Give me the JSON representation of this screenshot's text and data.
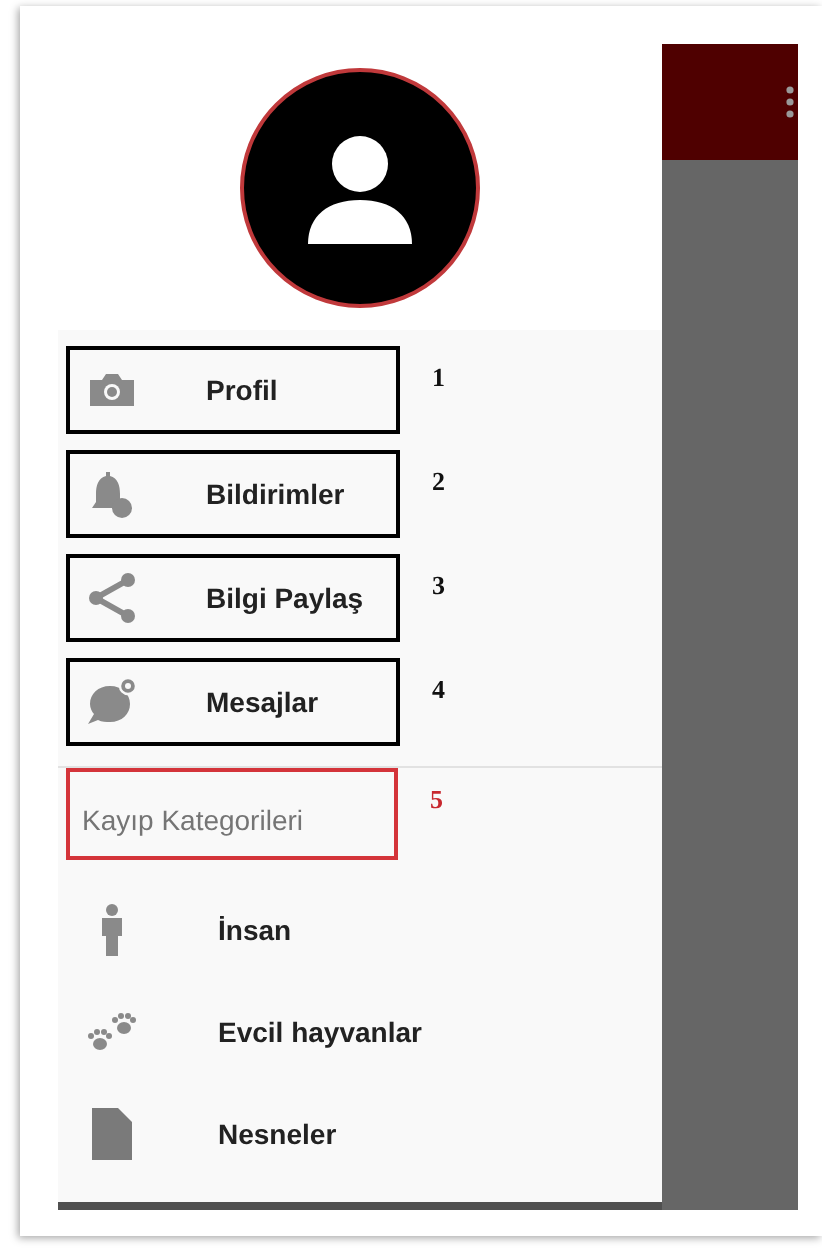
{
  "drawer": {
    "menu_items": [
      {
        "label": "Profil",
        "annotation": "1"
      },
      {
        "label": "Bildirimler",
        "annotation": "2"
      },
      {
        "label": "Bilgi Paylaş",
        "annotation": "3"
      },
      {
        "label": "Mesajlar",
        "annotation": "4"
      }
    ],
    "section": {
      "title": "Kayıp Kategorileri",
      "annotation": "5"
    },
    "categories": [
      {
        "label": "İnsan"
      },
      {
        "label": "Evcil hayvanlar"
      },
      {
        "label": "Nesneler"
      }
    ]
  }
}
